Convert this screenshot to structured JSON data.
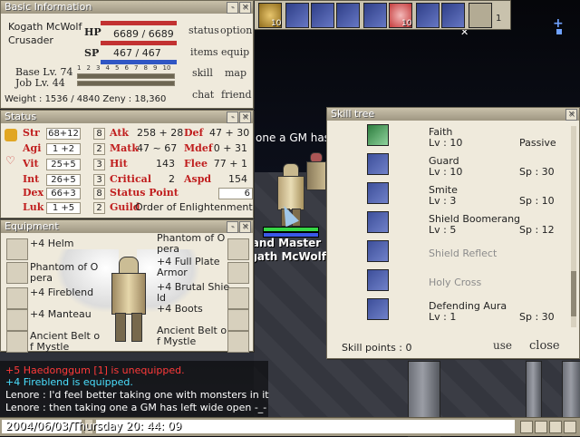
{
  "scene": {
    "overhead_chat": "one a GM has",
    "player_title": "Grand Master",
    "player_name": "Kogath McWolf",
    "top_right_count": "1"
  },
  "basic_info": {
    "title": "Basic Information",
    "name": "Kogath McWolf",
    "job": "Crusader",
    "hp_label": "HP",
    "hp_value": "6689  /  6689",
    "hp_fraction": 1.0,
    "sp_label": "SP",
    "sp_value": "467  /  467",
    "sp_fraction": 1.0,
    "base_lv": "Base Lv. 74",
    "job_lv": "Job Lv. 44",
    "scale_ticks": [
      "1",
      "2",
      "3",
      "4",
      "5",
      "6",
      "7",
      "8",
      "9",
      "10"
    ],
    "weight_zeny": "Weight : 1536 / 4840 Zeny : 18,360",
    "menu": [
      "status",
      "option",
      "items",
      "equip",
      "skill",
      "map",
      "chat",
      "friend"
    ]
  },
  "status": {
    "title": "Status",
    "stats": [
      {
        "label": "Str",
        "value": "68+12",
        "cost": "8"
      },
      {
        "label": "Agi",
        "value": "1 +2",
        "cost": "2"
      },
      {
        "label": "Vit",
        "value": "25+5",
        "cost": "3"
      },
      {
        "label": "Int",
        "value": "26+5",
        "cost": "3"
      },
      {
        "label": "Dex",
        "value": "66+3",
        "cost": "8"
      },
      {
        "label": "Luk",
        "value": "1 +5",
        "cost": "2"
      }
    ],
    "mid": [
      {
        "label": "Atk",
        "value": "258 + 28"
      },
      {
        "label": "Matk",
        "value": "47 ~ 67"
      },
      {
        "label": "Hit",
        "value": "143"
      },
      {
        "label": "Critical",
        "value": "2"
      },
      {
        "label": "Status Point",
        "value": "6"
      },
      {
        "label": "Guild",
        "value": "Order of Enlightenment"
      }
    ],
    "right": [
      {
        "label": "Def",
        "value": "47 + 30"
      },
      {
        "label": "Mdef",
        "value": "0 + 31"
      },
      {
        "label": "Flee",
        "value": "77 + 1"
      },
      {
        "label": "Aspd",
        "value": "154"
      }
    ]
  },
  "equipment": {
    "title": "Equipment",
    "left": [
      "+4 Helm",
      "Phantom of O\npera",
      "+4 Fireblend",
      "+4 Manteau",
      "Ancient Belt o\nf Mystle"
    ],
    "right": [
      "Phantom of O\npera",
      "+4 Full Plate\nArmor",
      "+4 Brutal Shie\nld",
      "+4 Boots",
      "Ancient Belt o\nf Mystle"
    ]
  },
  "skill_tree": {
    "title": "Skill tree",
    "skills": [
      {
        "name": "Faith",
        "lv": "Lv : 10",
        "extra": "Passive",
        "disabled": false
      },
      {
        "name": "Guard",
        "lv": "Lv : 10",
        "extra": "Sp : 30",
        "disabled": false
      },
      {
        "name": "Smite",
        "lv": "Lv : 3",
        "extra": "Sp : 10",
        "disabled": false
      },
      {
        "name": "Shield Boomerang",
        "lv": "Lv : 5",
        "extra": "Sp : 12",
        "disabled": false
      },
      {
        "name": "Shield Reflect",
        "lv": "",
        "extra": "",
        "disabled": true
      },
      {
        "name": "Holy Cross",
        "lv": "",
        "extra": "",
        "disabled": true
      },
      {
        "name": "Defending Aura",
        "lv": "Lv : 1",
        "extra": "Sp : 30",
        "disabled": false
      }
    ],
    "skill_points": "Skill points : 0",
    "use_label": "use",
    "close_label": "close"
  },
  "hotkeys": {
    "badges": [
      "10",
      "10"
    ]
  },
  "chat": {
    "lines": [
      {
        "text": "+5 Haedonggum [1] is unequipped.",
        "color": "#ff3a3a"
      },
      {
        "text": "+4 Fireblend is equipped.",
        "color": "#4be0ff"
      },
      {
        "text": "Lenore : I'd feel better taking one with monsters in it",
        "color": "#ffffff"
      },
      {
        "text": "Lenore : then taking one a GM has left wide open -_-",
        "color": "#ffffff"
      }
    ],
    "input_text": "2004/06/03/Thursday  20: 44: 09"
  }
}
